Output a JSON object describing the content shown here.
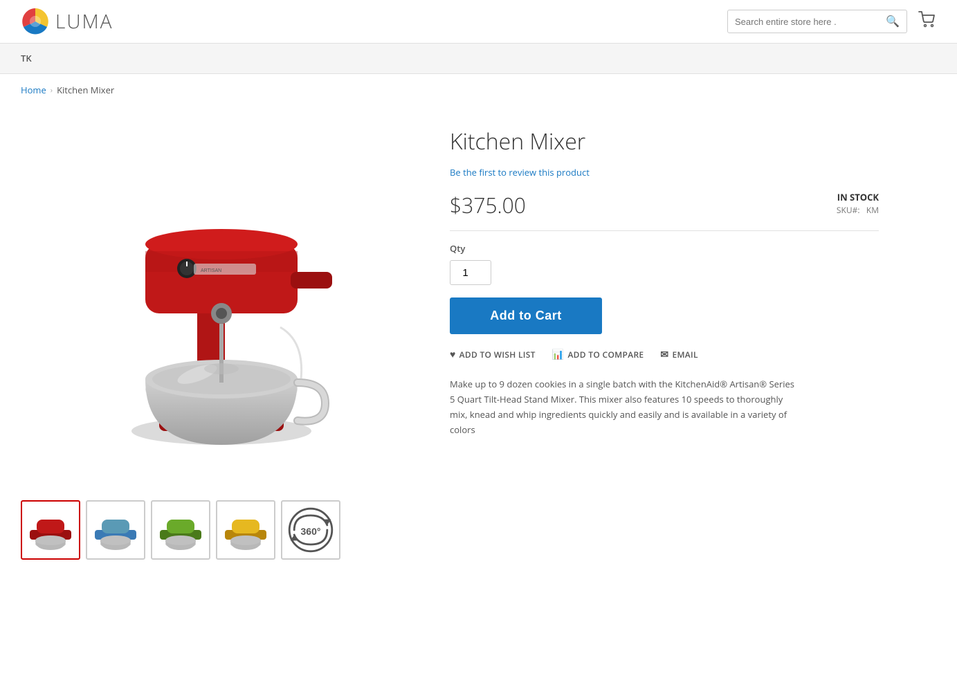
{
  "header": {
    "logo_text": "LUMA",
    "search_placeholder": "Search entire store here .",
    "cart_icon": "cart-icon"
  },
  "nav": {
    "user_label": "TK"
  },
  "breadcrumb": {
    "home_label": "Home",
    "separator": "›",
    "current_page": "Kitchen Mixer"
  },
  "product": {
    "title": "Kitchen Mixer",
    "review_link": "Be the first to review this product",
    "price": "$375.00",
    "stock_status": "IN STOCK",
    "sku_label": "SKU#:",
    "sku_value": "KM",
    "qty_label": "Qty",
    "qty_value": "1",
    "add_to_cart_label": "Add to Cart",
    "wishlist_label": "ADD TO WISH LIST",
    "compare_label": "ADD TO COMPARE",
    "email_label": "EMAIL",
    "description": "Make up to 9 dozen cookies in a single batch with the KitchenAid® Artisan® Series 5 Quart Tilt-Head Stand Mixer. This mixer also features 10 speeds to thoroughly mix, knead and whip ingredients quickly and easily and is available in a variety of colors"
  },
  "thumbnails": [
    {
      "color": "red",
      "label": "Red mixer thumbnail",
      "active": true
    },
    {
      "color": "blue",
      "label": "Blue mixer thumbnail",
      "active": false
    },
    {
      "color": "green",
      "label": "Green mixer thumbnail",
      "active": false
    },
    {
      "color": "yellow",
      "label": "Yellow mixer thumbnail",
      "active": false
    },
    {
      "color": "360",
      "label": "360 degree view",
      "active": false
    }
  ]
}
